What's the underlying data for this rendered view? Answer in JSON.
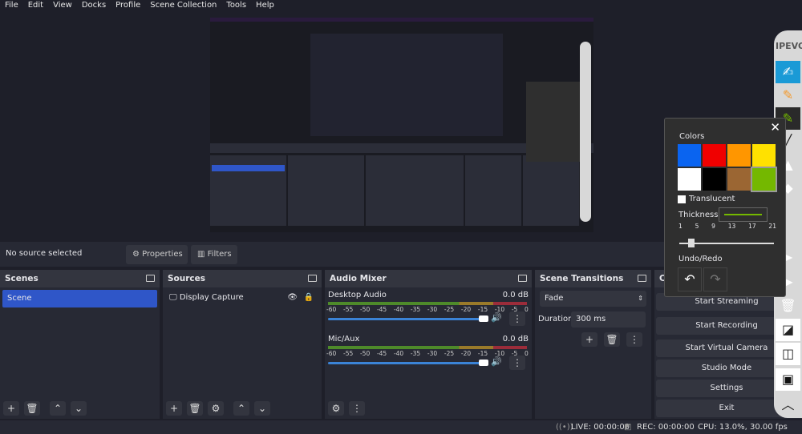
{
  "menu": [
    "File",
    "Edit",
    "View",
    "Docks",
    "Profile",
    "Scene Collection",
    "Tools",
    "Help"
  ],
  "source_bar": {
    "status": "No source selected",
    "properties": "Properties",
    "filters": "Filters"
  },
  "scenes": {
    "title": "Scenes",
    "items": [
      "Scene"
    ]
  },
  "sources": {
    "title": "Sources",
    "items": [
      "Display Capture"
    ]
  },
  "audio_mixer": {
    "title": "Audio Mixer",
    "ticks": [
      "-60",
      "-55",
      "-50",
      "-45",
      "-40",
      "-35",
      "-30",
      "-25",
      "-20",
      "-15",
      "-10",
      "-5",
      "0"
    ],
    "channels": [
      {
        "name": "Desktop Audio",
        "level": "0.0 dB",
        "volume": 1.0
      },
      {
        "name": "Mic/Aux",
        "level": "0.0 dB",
        "volume": 1.0
      }
    ]
  },
  "transitions": {
    "title": "Scene Transitions",
    "selected": "Fade",
    "duration_label": "Duration",
    "duration": "300 ms"
  },
  "controls": {
    "title": "C",
    "buttons": [
      "Start Streaming",
      "Start Recording",
      "Start Virtual Camera",
      "Studio Mode",
      "Settings",
      "Exit"
    ]
  },
  "status": {
    "live": "LIVE: 00:00:00",
    "rec": "REC: 00:00:00",
    "cpu": "CPU: 13.0%, 30.00 fps"
  },
  "ipevo": {
    "logo": "IPEVO",
    "tools": [
      "annotate-icon",
      "highlighter-icon",
      "pen-icon",
      "line-icon",
      "stamp-icon",
      "eraser-icon",
      "pointer-icon",
      "play-icon",
      "clear-icon",
      "whiteboard-icon",
      "overlay-icon",
      "camera-icon",
      "collapse-icon"
    ]
  },
  "popup": {
    "colors_label": "Colors",
    "colors": [
      "#0a64f0",
      "#f00000",
      "#ff9600",
      "#ffe100",
      "#ffffff",
      "#000000",
      "#9b6633",
      "#74b800"
    ],
    "selected_color": "#74b800",
    "translucent": "Translucent",
    "translucent_checked": false,
    "thickness_label": "Thickness",
    "thickness_ticks": [
      "1",
      "5",
      "9",
      "13",
      "17",
      "21"
    ],
    "thickness": 3,
    "undo_redo": "Undo/Redo"
  }
}
